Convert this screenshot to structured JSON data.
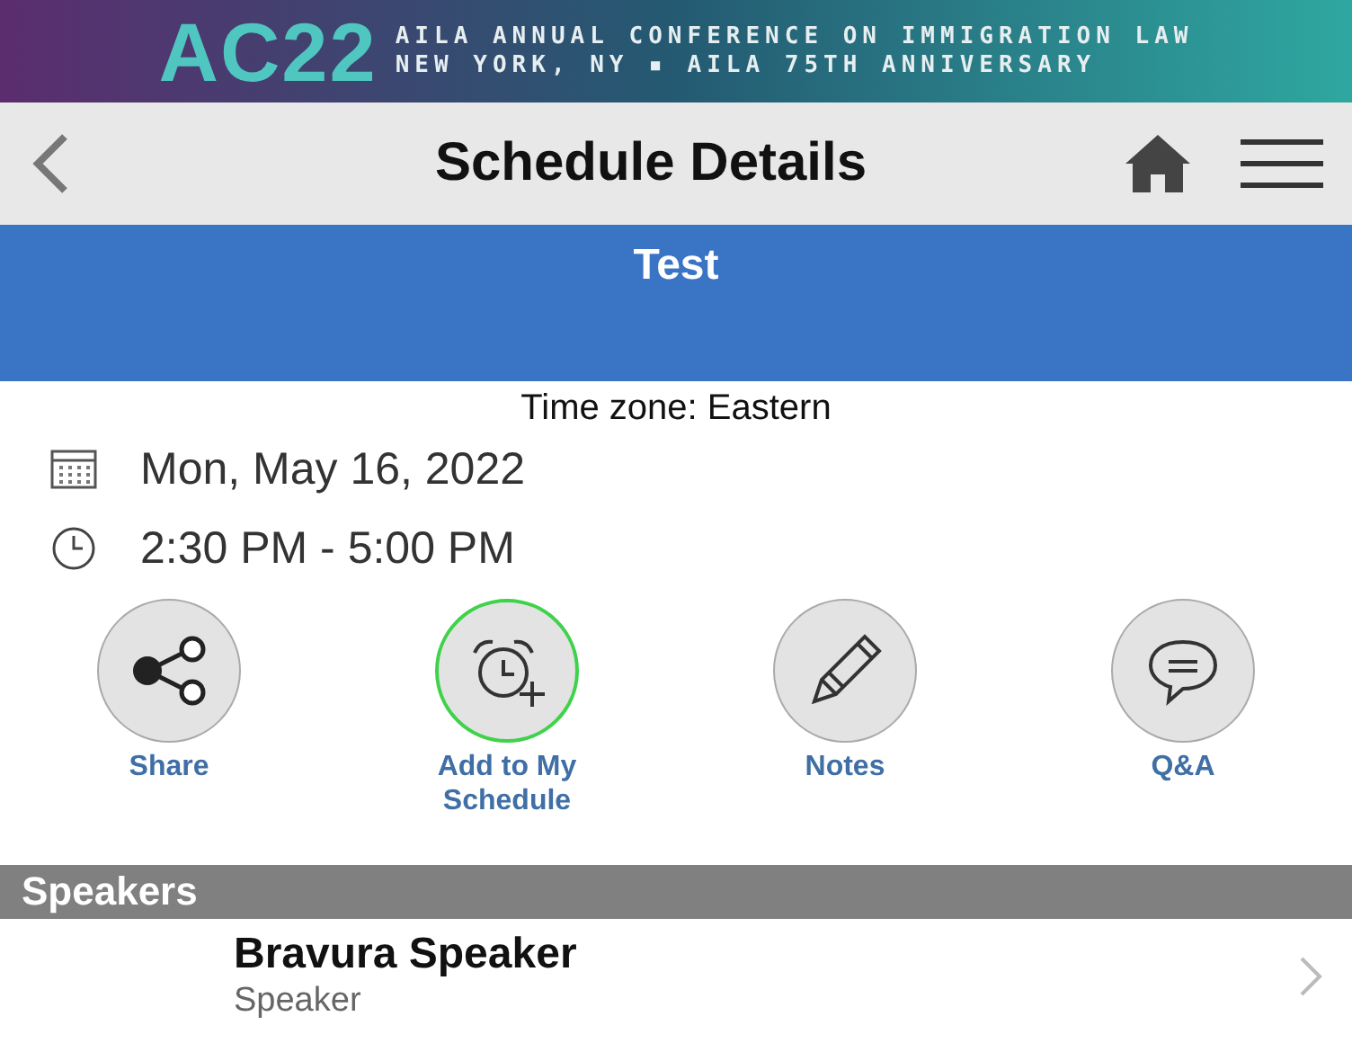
{
  "banner": {
    "logo": "AC22",
    "line_1": "AILA ANNUAL CONFERENCE ON IMMIGRATION LAW",
    "line_2": "NEW YORK, NY ▪ AILA 75TH ANNIVERSARY"
  },
  "nav": {
    "title": "Schedule Details"
  },
  "session": {
    "title": "Test"
  },
  "time_zone": "Time zone: Eastern",
  "date": "Mon, May 16, 2022",
  "time": "2:30 PM - 5:00 PM",
  "actions": [
    {
      "kind": "share",
      "label": "Share",
      "active": false
    },
    {
      "kind": "alarm",
      "label": "Add to My Schedule",
      "active": true
    },
    {
      "kind": "pencil",
      "label": "Notes",
      "active": false
    },
    {
      "kind": "chat",
      "label": "Q&A",
      "active": false
    }
  ],
  "speakers": {
    "header": "Speakers",
    "items": [
      {
        "name": "Bravura Speaker",
        "role": "Speaker"
      }
    ]
  }
}
